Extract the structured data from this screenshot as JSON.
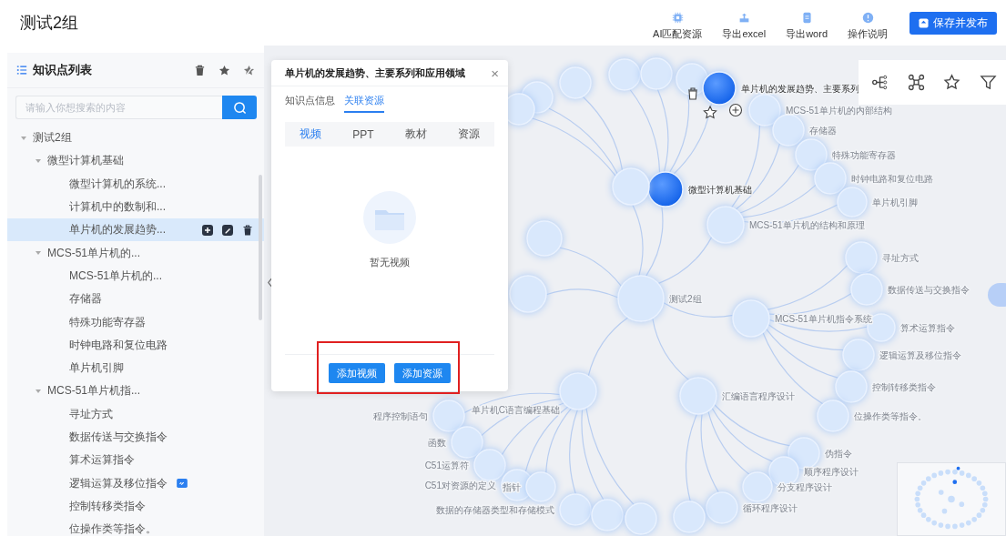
{
  "page_title": "测试2组",
  "toolbar": [
    {
      "label": "AI匹配资源",
      "kind": "ai"
    },
    {
      "label": "导出excel",
      "kind": "excel"
    },
    {
      "label": "导出word",
      "kind": "word"
    },
    {
      "label": "操作说明",
      "kind": "help"
    }
  ],
  "publish_button": "保存并发布",
  "sidebar": {
    "title": "知识点列表",
    "search": {
      "placeholder": "请输入你想搜索的内容"
    },
    "tree": [
      {
        "label": "测试2组",
        "expanded": true,
        "selected": false,
        "children": [
          {
            "label": "微型计算机基础",
            "expanded": true,
            "selected": false,
            "children": [
              {
                "label": "微型计算机的系统...",
                "selected": false,
                "linked": false
              },
              {
                "label": "计算机中的数制和...",
                "selected": false,
                "linked": false
              },
              {
                "label": "单片机的发展趋势...",
                "selected": true,
                "linked": false
              }
            ]
          },
          {
            "label": "MCS-51单片机的...",
            "expanded": true,
            "selected": false,
            "children": [
              {
                "label": "MCS-51单片机的...",
                "selected": false,
                "linked": false
              },
              {
                "label": "存储器",
                "selected": false,
                "linked": false
              },
              {
                "label": "特殊功能寄存器",
                "selected": false,
                "linked": false
              },
              {
                "label": "时钟电路和复位电路",
                "selected": false,
                "linked": false
              },
              {
                "label": "单片机引脚",
                "selected": false,
                "linked": false
              }
            ]
          },
          {
            "label": "MCS-51单片机指...",
            "expanded": true,
            "selected": false,
            "children": [
              {
                "label": "寻址方式",
                "selected": false,
                "linked": false
              },
              {
                "label": "数据传送与交换指令",
                "selected": false,
                "linked": false
              },
              {
                "label": "算术运算指令",
                "selected": false,
                "linked": false
              },
              {
                "label": "逻辑运算及移位指令",
                "selected": false,
                "linked": true
              },
              {
                "label": "控制转移类指令",
                "selected": false,
                "linked": false
              },
              {
                "label": "位操作类等指令。",
                "selected": false,
                "linked": false
              }
            ]
          }
        ]
      }
    ]
  },
  "popup": {
    "title": "单片机的发展趋势、主要系列和应用领域",
    "close": "×",
    "tabs": [
      {
        "label": "知识点信息",
        "selected": false
      },
      {
        "label": "关联资源",
        "selected": true
      }
    ],
    "resource_tabs": [
      {
        "label": "视频",
        "selected": true
      },
      {
        "label": "PPT",
        "selected": false
      },
      {
        "label": "教材",
        "selected": false
      },
      {
        "label": "资源",
        "selected": false
      }
    ],
    "empty_text": "暂无视频",
    "buttons": [
      "添加视频",
      "添加资源"
    ]
  },
  "graph": {
    "root": {
      "label": "测试2组",
      "active": false,
      "children": [
        {
          "label": "微型计算机基础",
          "active": true,
          "children": [
            {
              "active": false
            },
            {
              "active": false
            },
            {
              "active": false
            },
            {
              "label": "单片机的发展趋势、主要系列",
              "active": true
            }
          ]
        },
        {
          "label": "MCS-51单片机的结构和原理",
          "active": false,
          "children": [
            {
              "label": "MCS-51单片机的内部结构",
              "active": false
            },
            {
              "label": "存储器",
              "active": false
            },
            {
              "label": "特殊功能寄存器",
              "active": false
            },
            {
              "label": "时钟电路和复位电路",
              "active": false
            },
            {
              "label": "单片机引脚",
              "active": false
            }
          ]
        },
        {
          "label": "MCS-51单片机指令系统",
          "active": false,
          "children": [
            {
              "label": "寻址方式",
              "active": false
            },
            {
              "label": "数据传送与交换指令",
              "active": false
            },
            {
              "label": "算术运算指令",
              "active": false
            },
            {
              "label": "逻辑运算及移位指令",
              "active": false
            },
            {
              "label": "控制转移类指令",
              "active": false
            },
            {
              "label": "位操作类等指令。",
              "active": false
            }
          ]
        },
        {
          "label": "单片机C语言编程基础",
          "active": false,
          "children": [
            {
              "label": "程序控制语句",
              "active": false
            },
            {
              "label": "函数",
              "active": false
            },
            {
              "label": "C51运算符",
              "active": false
            },
            {
              "label": "C51对资源的定义",
              "active": false
            },
            {
              "label": "指针",
              "active": false
            },
            {
              "label": "数据的存储器类型和存储模式",
              "active": false
            },
            {
              "active": false
            },
            {
              "active": false
            }
          ]
        },
        {
          "label": "汇编语言程序设计",
          "active": false,
          "children": [
            {
              "label": "伪指令",
              "active": false
            },
            {
              "label": "顺序程序设计",
              "active": false
            },
            {
              "label": "分支程序设计",
              "active": false
            },
            {
              "label": "循环程序设计",
              "active": false
            },
            {
              "active": false
            }
          ]
        },
        {
          "active": false,
          "children": [
            {
              "active": false
            },
            {
              "active": false
            },
            {
              "active": false
            }
          ]
        },
        {
          "active": false
        },
        {
          "active": false
        }
      ]
    }
  }
}
